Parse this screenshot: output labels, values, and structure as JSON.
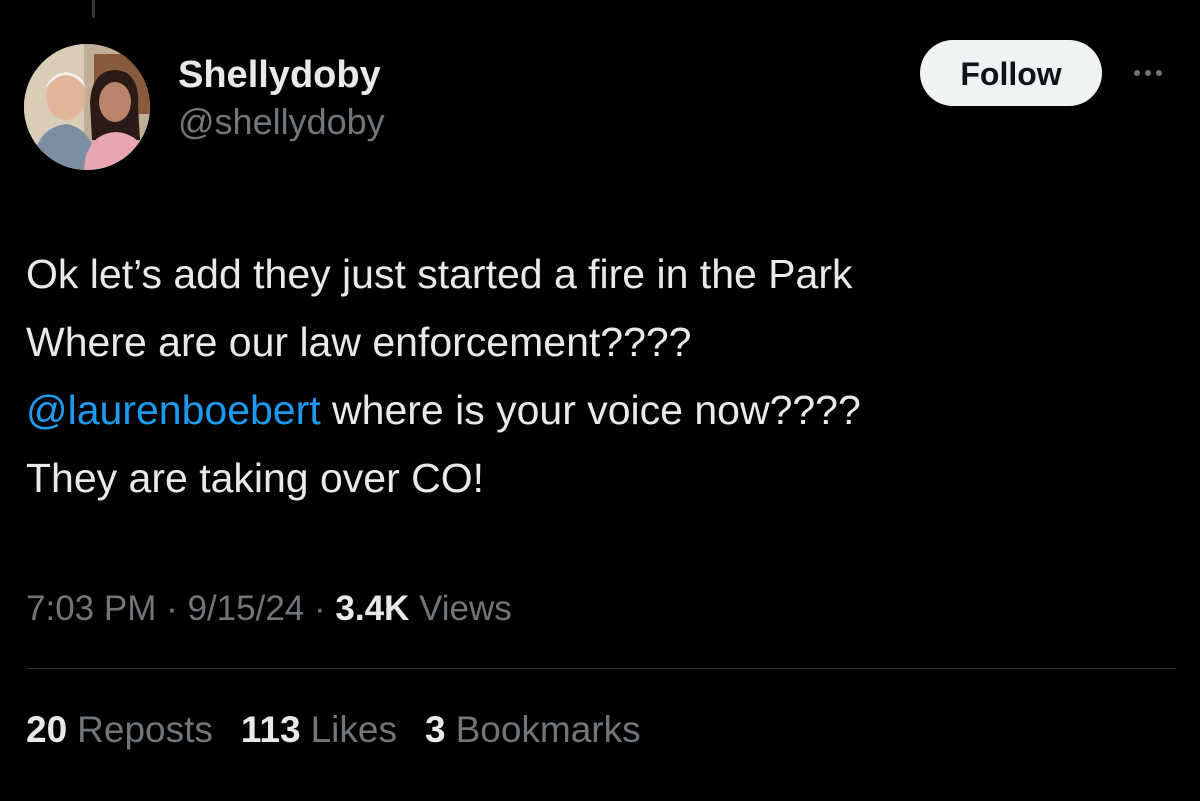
{
  "author": {
    "display_name": "Shellydoby",
    "handle": "@shellydoby"
  },
  "actions": {
    "follow_label": "Follow"
  },
  "tweet": {
    "line1": "Ok let’s add they just started a fire in the Park",
    "line2": "Where are our law enforcement????",
    "line3_mention": "@laurenboebert",
    "line3_rest": " where is your voice now????",
    "line4": "They are taking over CO!"
  },
  "meta": {
    "time": "7:03 PM",
    "date": "9/15/24",
    "views_count": "3.4K",
    "views_label": "Views",
    "separator": "·"
  },
  "stats": {
    "reposts_count": "20",
    "reposts_label": "Reposts",
    "likes_count": "113",
    "likes_label": "Likes",
    "bookmarks_count": "3",
    "bookmarks_label": "Bookmarks"
  },
  "colors": {
    "background": "#000000",
    "text_primary": "#e7e9ea",
    "text_secondary": "#71767b",
    "link": "#1d9bf0",
    "follow_button_bg": "#eff3f4",
    "divider": "#2f3336"
  }
}
